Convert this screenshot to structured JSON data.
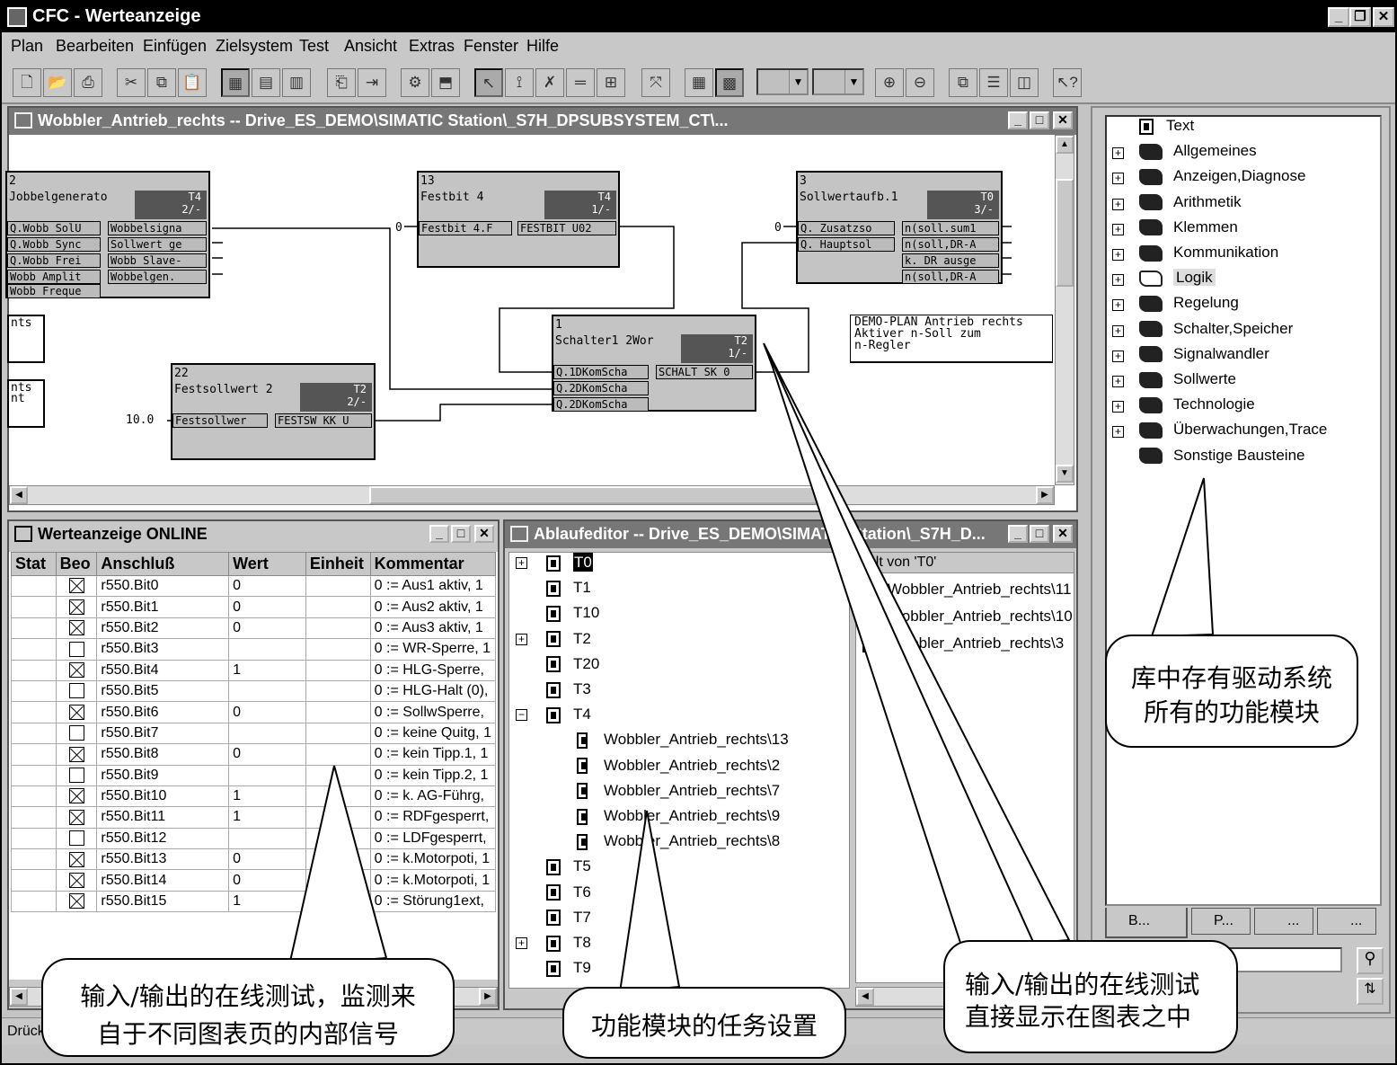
{
  "window": {
    "title": "CFC - Werteanzeige"
  },
  "menu": [
    "Plan",
    "Bearbeiten",
    "Einfügen",
    "Zielsystem",
    "Test",
    "Ansicht",
    "Extras",
    "Fenster",
    "Hilfe"
  ],
  "chart_window": {
    "title": "Wobbler_Antrieb_rechts -- Drive_ES_DEMO\\SIMATIC Station\\_S7H_DPSUBSYSTEM_CT\\...",
    "blocks": [
      {
        "num": "2",
        "name": "Jobbelgenerato",
        "tag": "T4\n2/-",
        "inputs": [
          "Q.Wobb SolU",
          "Q.Wobb Sync",
          "Q.Wobb Frei",
          "Wobb Amplit",
          "Wobb Freque"
        ],
        "outputs": [
          "Wobbelsigna",
          "Sollwert ge",
          "Wobb Slave-",
          "Wobbelgen."
        ]
      },
      {
        "num": "13",
        "name": "Festbit 4",
        "tag": "T4\n1/-",
        "inputs": [
          "Festbit 4.F"
        ],
        "outputs": [
          "FESTBIT U02"
        ],
        "in_value": "0"
      },
      {
        "num": "3",
        "name": "Sollwertaufb.1",
        "tag": "T0\n3/-",
        "inputs": [
          "Q. Zusatzso",
          "Q. Hauptsol"
        ],
        "outputs": [
          "n(soll.sum1",
          "n(soll,DR-A",
          "k. DR ausge",
          "n(soll,DR-A"
        ],
        "in_value": "0"
      },
      {
        "num": "1",
        "name": "Schalter1 2Wor",
        "tag": "T2\n1/-",
        "inputs": [
          "Q.1DKomScha",
          "Q.2DKomScha",
          "Q.2DKomScha"
        ],
        "outputs": [
          "SCHALT SK 0"
        ]
      },
      {
        "num": "22",
        "name": "Festsollwert 2",
        "tag": "T2\n2/-",
        "inputs": [
          "Festsollwer"
        ],
        "outputs": [
          "FESTSW KK U"
        ],
        "in_value": "10.0"
      }
    ],
    "comment": [
      "DEMO-PLAN Antrieb rechts",
      "Aktiver n-Soll zum",
      "n-Regler"
    ],
    "offpage1": "nts",
    "offpage2": [
      "nts",
      "nt"
    ]
  },
  "werte_window": {
    "title": "Werteanzeige  ONLINE",
    "columns": [
      "Stat",
      "Beo",
      "Anschluß",
      "Wert",
      "Einheit",
      "Kommentar"
    ],
    "rows": [
      {
        "beo": true,
        "anschluss": "r550.Bit0",
        "wert": "0",
        "kommentar": "0 := Aus1 aktiv, 1"
      },
      {
        "beo": true,
        "anschluss": "r550.Bit1",
        "wert": "0",
        "kommentar": "0 := Aus2 aktiv, 1"
      },
      {
        "beo": true,
        "anschluss": "r550.Bit2",
        "wert": "0",
        "kommentar": "0 := Aus3 aktiv, 1"
      },
      {
        "beo": false,
        "anschluss": "r550.Bit3",
        "wert": "",
        "kommentar": "0 := WR-Sperre, 1"
      },
      {
        "beo": true,
        "anschluss": "r550.Bit4",
        "wert": "1",
        "kommentar": "0 := HLG-Sperre,"
      },
      {
        "beo": false,
        "anschluss": "r550.Bit5",
        "wert": "",
        "kommentar": "0 := HLG-Halt (0),"
      },
      {
        "beo": true,
        "anschluss": "r550.Bit6",
        "wert": "0",
        "kommentar": "0 := SollwSperre,"
      },
      {
        "beo": false,
        "anschluss": "r550.Bit7",
        "wert": "",
        "kommentar": "0 := keine Quitg, 1"
      },
      {
        "beo": true,
        "anschluss": "r550.Bit8",
        "wert": "0",
        "kommentar": "0 := kein Tipp.1, 1"
      },
      {
        "beo": false,
        "anschluss": "r550.Bit9",
        "wert": "",
        "kommentar": "0 := kein Tipp.2, 1"
      },
      {
        "beo": true,
        "anschluss": "r550.Bit10",
        "wert": "1",
        "kommentar": "0 := k. AG-Führg,"
      },
      {
        "beo": true,
        "anschluss": "r550.Bit11",
        "wert": "1",
        "kommentar": "0 := RDFgesperrt,"
      },
      {
        "beo": false,
        "anschluss": "r550.Bit12",
        "wert": "",
        "kommentar": "0 := LDFgesperrt,"
      },
      {
        "beo": true,
        "anschluss": "r550.Bit13",
        "wert": "0",
        "kommentar": "0 := k.Motorpoti, 1"
      },
      {
        "beo": true,
        "anschluss": "r550.Bit14",
        "wert": "0",
        "kommentar": "0 := k.Motorpoti, 1"
      },
      {
        "beo": true,
        "anschluss": "r550.Bit15",
        "wert": "1",
        "kommentar": "0 := Störung1ext,"
      }
    ]
  },
  "ablauf_window": {
    "title": "Ablaufeditor -- Drive_ES_DEMO\\SIMATIC Station\\_S7H_D...",
    "tasks": [
      "T0",
      "T1",
      "T10",
      "T2",
      "T20",
      "T3",
      "T4",
      "T5",
      "T6",
      "T7",
      "T8",
      "T9"
    ],
    "t4_children": [
      "Wobbler_Antrieb_rechts\\13",
      "Wobbler_Antrieb_rechts\\2",
      "Wobbler_Antrieb_rechts\\7",
      "Wobbler_Antrieb_rechts\\9",
      "Wobbler_Antrieb_rechts\\8"
    ],
    "right_header": "halt von 'T0'",
    "right_items": [
      "Wobbler_Antrieb_rechts\\11",
      "Wobbler_Antrieb_rechts\\10",
      "Wobbler_Antrieb_rechts\\3"
    ]
  },
  "library": {
    "items": [
      "Text",
      "Allgemeines",
      "Anzeigen,Diagnose",
      "Arithmetik",
      "Klemmen",
      "Kommunikation",
      "Logik",
      "Regelung",
      "Schalter,Speicher",
      "Signalwandler",
      "Sollwerte",
      "Technologie",
      "Überwachungen,Trace",
      "Sonstige Bausteine"
    ],
    "tabs": [
      "B...",
      "P...",
      "...",
      "..."
    ]
  },
  "status_bar": "Drück",
  "callouts": {
    "library": [
      "库中存有驱动系统",
      "所有的功能模块"
    ],
    "werte": [
      "输入/输出的在线测试，监测来",
      "自于不同图表页的内部信号"
    ],
    "ablauf": "功能模块的任务设置",
    "chart": [
      "输入/输出的在线测试",
      "直接显示在图表之中"
    ]
  }
}
